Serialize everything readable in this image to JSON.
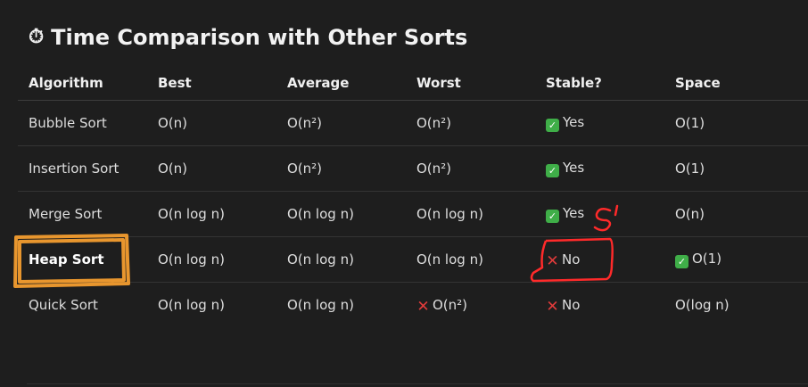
{
  "title": {
    "icon": "stopwatch-icon",
    "text": "Time Comparison with Other Sorts"
  },
  "table": {
    "headers": [
      "Algorithm",
      "Best",
      "Average",
      "Worst",
      "Stable?",
      "Space"
    ],
    "rows": [
      {
        "algorithm": "Bubble Sort",
        "best": "O(n)",
        "average": "O(n²)",
        "worst": "O(n²)",
        "stable": "Yes",
        "space": "O(1)"
      },
      {
        "algorithm": "Insertion Sort",
        "best": "O(n)",
        "average": "O(n²)",
        "worst": "O(n²)",
        "stable": "Yes",
        "space": "O(1)"
      },
      {
        "algorithm": "Merge Sort",
        "best": "O(n log n)",
        "average": "O(n log n)",
        "worst": "O(n log n)",
        "stable": "Yes",
        "space": "O(n)"
      },
      {
        "algorithm": "Heap Sort",
        "best": "O(n log n)",
        "average": "O(n log n)",
        "worst": "O(n log n)",
        "stable": "No",
        "space": "O(1)"
      },
      {
        "algorithm": "Quick Sort",
        "best": "O(n log n)",
        "average": "O(n log n)",
        "worst": "O(n²)",
        "stable": "No",
        "space": "O(log n)"
      }
    ]
  },
  "annotations": {
    "heap_sort_box_color": "#e8962e",
    "stable_no_box_color": "#ff2a2a",
    "handwritten_mark_color": "#ff2a2a"
  },
  "colors": {
    "background": "#1e1e1e",
    "check": "#3fae48",
    "cross": "#e23b3b"
  }
}
